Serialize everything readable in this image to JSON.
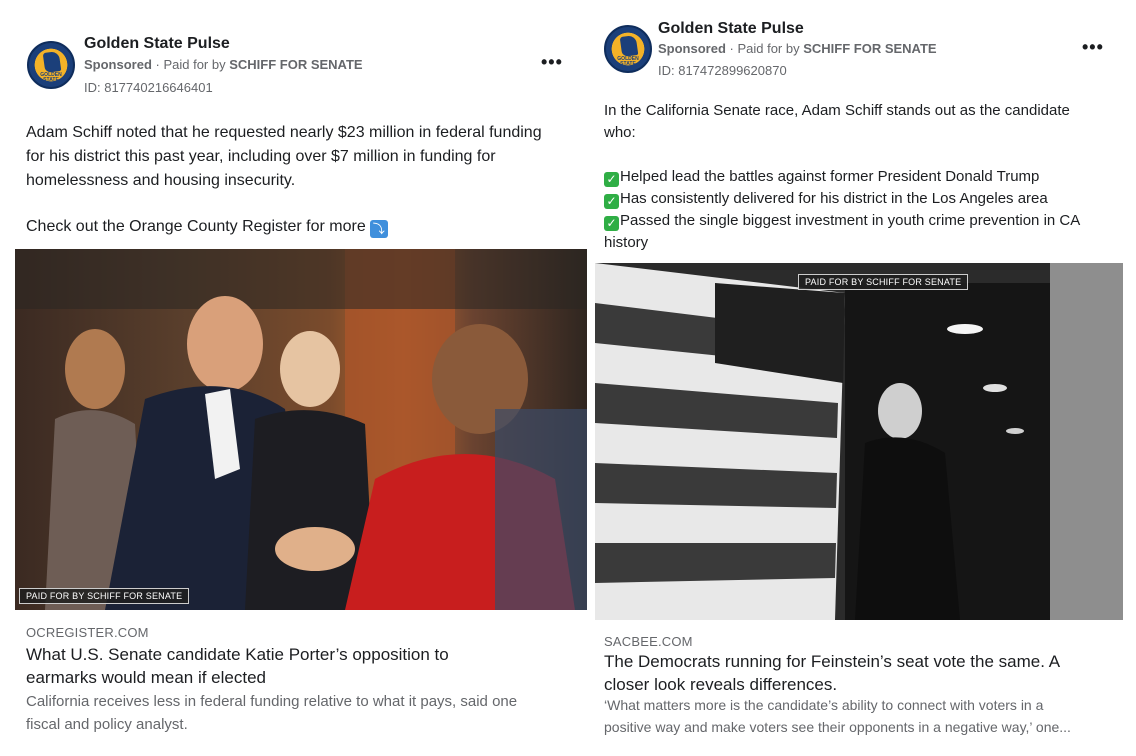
{
  "ads": [
    {
      "page_name": "Golden State Pulse",
      "sponsored_label": "Sponsored",
      "paid_for_prefix": " · Paid for by ",
      "paid_for_by": "SCHIFF FOR SENATE",
      "ad_id": "ID: 817740216646401",
      "body_lines": [
        "Adam Schiff noted that he requested nearly $23 million in federal funding",
        "for his district this past year, including over $7 million in funding for",
        "homelessness and housing insecurity."
      ],
      "cta_text": "Check out the Orange County Register for more",
      "image_tag": "PAID FOR BY SCHIFF FOR SENATE",
      "link_domain": "OCREGISTER.COM",
      "link_headline_lines": [
        "What U.S. Senate candidate Katie Porter’s opposition to",
        "earmarks would mean if elected"
      ],
      "link_description_lines": [
        "California receives less in federal funding relative to what it pays, said one",
        "fiscal and policy analyst."
      ]
    },
    {
      "page_name": "Golden State Pulse",
      "sponsored_label": "Sponsored",
      "paid_for_prefix": " · Paid for by ",
      "paid_for_by": "SCHIFF FOR SENATE",
      "ad_id": "ID: 817472899620870",
      "intro_lines": [
        "In the California Senate race, Adam Schiff stands out as the candidate",
        "who:"
      ],
      "bullets": [
        "Helped lead the battles against former President Donald Trump",
        "Has consistently delivered for his district in the Los Angeles area",
        "Passed the single biggest investment in youth crime prevention in CA"
      ],
      "bullet_overflow": "history",
      "image_tag": "PAID FOR BY SCHIFF FOR SENATE",
      "link_domain": "SACBEE.COM",
      "link_headline_lines": [
        "The Democrats running for Feinstein’s seat vote the same. A",
        "closer look reveals differences."
      ],
      "link_description_lines": [
        "‘What matters more is the candidate’s ability to connect with voters in a",
        "positive way and make voters see their opponents in a negative way,’ one..."
      ]
    }
  ],
  "icons": {
    "avatar": "golden-state-pulse-logo",
    "avatar_text": "GOLDEN STATE PULSE",
    "more": "more-options-icon",
    "more_glyph": "•••",
    "check": "check-mark-box-icon",
    "check_glyph": "✓",
    "arrow": "down-arrow-box-icon",
    "arrow_glyph": "⤵"
  },
  "colors": {
    "check_green": "#2fae45",
    "arrow_blue": "#3f8fdc",
    "secondary_text": "#65676b",
    "primary_text": "#1c1e21",
    "logo_gold": "#f3b228",
    "logo_navy": "#1b3f7a"
  }
}
